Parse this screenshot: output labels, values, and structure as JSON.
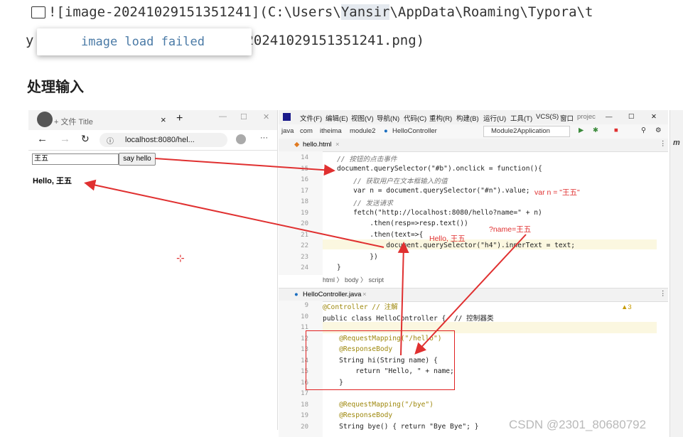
{
  "markdown": {
    "line1": "![image-20241029151351241](C:\\Users\\",
    "highlight": "Yansir",
    "line1_tail": "\\AppData\\Roaming\\Typora\\t",
    "line2_start": "y",
    "line2_tail": "20241029151351241.png)",
    "load_failed": "image load failed",
    "heading": "处理输入"
  },
  "browser": {
    "tab_title": "+ 文件 Title",
    "url": "localhost:8080/hel...",
    "input_value": "王五",
    "button_label": "say hello",
    "output": "Hello, 王五"
  },
  "ide": {
    "menu": [
      "文件(F)",
      "编辑(E)",
      "视图(V)",
      "导航(N)",
      "代码(C)",
      "重构(R)",
      "构建(B)",
      "运行(U)",
      "工具(T)",
      "VCS(S)",
      "窗口",
      "projec"
    ],
    "breadcrumb": [
      "java",
      "com",
      "itheima",
      "module2",
      "HelloController"
    ],
    "run_config": "Module2Application",
    "tab1": "hello.html",
    "tab2": "HelloController.java",
    "html_crumbs": "html 〉 body 〉 script",
    "html_lines": [
      {
        "n": "14",
        "code": "// 按钮的点击事件"
      },
      {
        "n": "15",
        "code": "document.querySelector(\"#b\").onclick = function(){"
      },
      {
        "n": "16",
        "code": "    // 获取用户在文本框输入的值"
      },
      {
        "n": "17",
        "code": "    var n = document.querySelector(\"#n\").value;"
      },
      {
        "n": "18",
        "code": "    // 发送请求"
      },
      {
        "n": "19",
        "code": "    fetch(\"http://localhost:8080/hello?name=\" + n)"
      },
      {
        "n": "20",
        "code": "        .then(resp=>resp.text())"
      },
      {
        "n": "21",
        "code": "        .then(text=>{"
      },
      {
        "n": "22",
        "code": "            document.querySelector(\"h4\").innerText = text;"
      },
      {
        "n": "23",
        "code": "        })"
      },
      {
        "n": "24",
        "code": "}"
      }
    ],
    "java_lines": [
      {
        "n": "9",
        "code": "@Controller // 注解"
      },
      {
        "n": "10",
        "code": "public class HelloController {  // 控制器类"
      },
      {
        "n": "11",
        "code": ""
      },
      {
        "n": "12",
        "code": "    @RequestMapping(\"/hello\")"
      },
      {
        "n": "13",
        "code": "    @ResponseBody"
      },
      {
        "n": "14",
        "code": "    String hi(String name) {"
      },
      {
        "n": "15",
        "code": "        return \"Hello, \" + name;"
      },
      {
        "n": "16",
        "code": "    }"
      },
      {
        "n": "17",
        "code": ""
      },
      {
        "n": "18",
        "code": "    @RequestMapping(\"/bye\")"
      },
      {
        "n": "19",
        "code": "    @ResponseBody"
      },
      {
        "n": "20",
        "code": "    String bye() { return \"Bye Bye\"; }"
      }
    ],
    "warn_count": "▲3",
    "annotations": {
      "var_n": "var n = \"王五\"",
      "hello": "Hello, 王五",
      "query": "?name=王五"
    }
  },
  "watermark": "CSDN @2301_80680792",
  "colors": {
    "arrow": "#e03030",
    "keyword": "#0033b3",
    "string": "#067d17",
    "annotation": "#9e880d"
  }
}
